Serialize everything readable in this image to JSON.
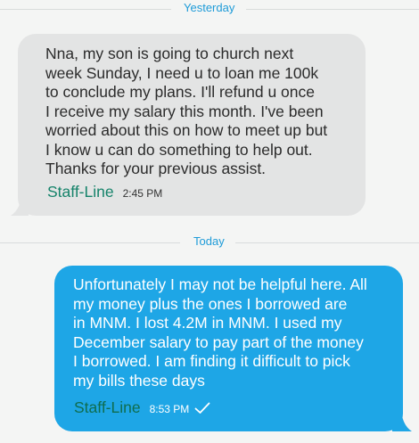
{
  "dividers": {
    "yesterday": "Yesterday",
    "today": "Today"
  },
  "messages": [
    {
      "direction": "incoming",
      "text": "Nna, my son is going to church next\nweek Sunday, I need u to loan me 100k\nto conclude my plans. I'll refund u once\nI receive my salary this month. I've been\nworried about this on how to meet up but\nI know u can do something to help out.\nThanks for your previous assist.",
      "sender": "Staff-Line",
      "time": "2:45 PM"
    },
    {
      "direction": "outgoing",
      "text": "Unfortunately I may not be helpful here. All\nmy money plus the ones I borrowed are\nin MNM. I lost 4.2M in MNM. I used my\nDecember salary to pay part of the money\nI borrowed. I am finding it difficult to pick\nmy bills these days",
      "sender": "Staff-Line",
      "time": "8:53 PM",
      "status_icon": "sent-check-icon"
    }
  ],
  "colors": {
    "background": "#f4f5f4",
    "incoming_bubble": "#e3e4e4",
    "outgoing_bubble": "#1ea6e6",
    "divider_label": "#1e9bd8",
    "incoming_sender": "#15836a",
    "outgoing_sender": "#0f6d4f"
  }
}
